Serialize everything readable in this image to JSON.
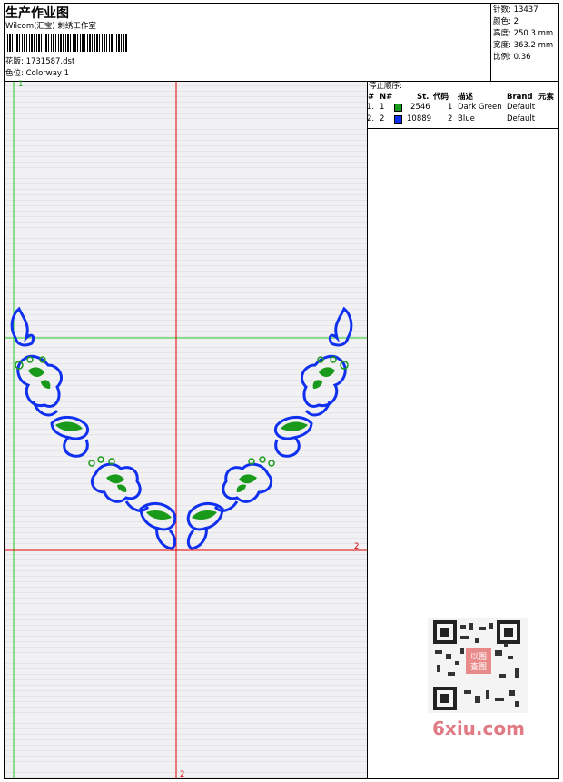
{
  "header": {
    "title": "生产作业图",
    "company": "Wilcom(汇宝) 刺绣工作室",
    "design_label": "花版:",
    "design_value": "1731587.dst",
    "colorway_label": "色位:",
    "colorway_value": "Colorway 1"
  },
  "stats": {
    "stitches_label": "针数:",
    "stitches_value": "13437",
    "colors_label": "颜色:",
    "colors_value": "2",
    "height_label": "高度:",
    "height_value": "250.3 mm",
    "width_label": "宽度:",
    "width_value": "363.2 mm",
    "scale_label": "比例:",
    "scale_value": "0.36"
  },
  "stop_sequence": {
    "title": "停止顺序:",
    "columns": [
      "#",
      "N#",
      "St.",
      "代码",
      "描述",
      "Brand",
      "元素"
    ],
    "rows": [
      {
        "idx": "1.",
        "n": "1",
        "color": "#1a9a1a",
        "st": "2546",
        "code": "1",
        "desc": "Dark Green",
        "brand": "Default"
      },
      {
        "idx": "2.",
        "n": "2",
        "color": "#1030f0",
        "st": "10889",
        "code": "2",
        "desc": "Blue",
        "brand": "Default"
      }
    ]
  },
  "axis_markers": {
    "top_left": "1",
    "right": "2",
    "bottom": "2"
  },
  "watermark": {
    "text": "6xiu.com",
    "qr_caption": "以图查图"
  },
  "colors": {
    "green_guide": "#22cc22",
    "red_guide": "#e00000",
    "thread_green": "#1a9a1a",
    "thread_blue": "#1030f0"
  }
}
